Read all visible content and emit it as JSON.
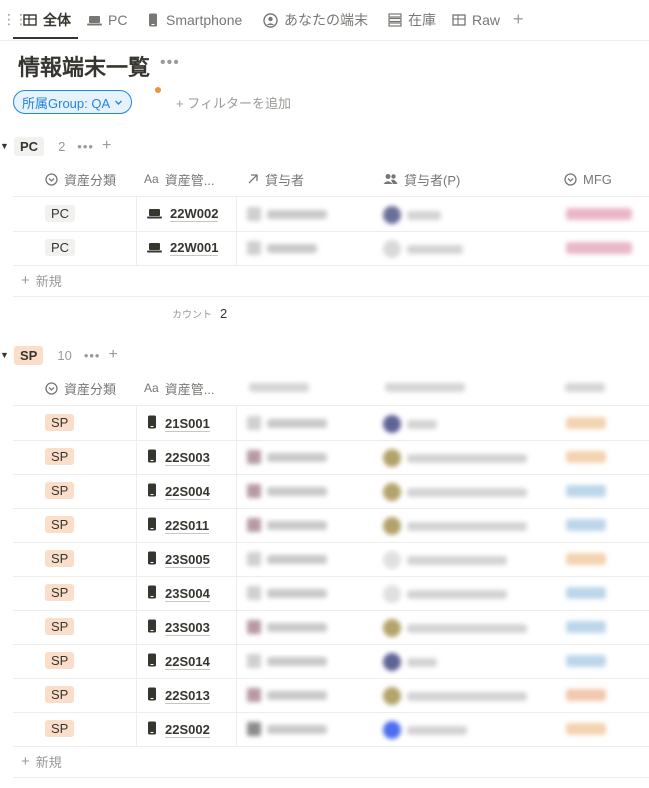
{
  "tabs": [
    {
      "label": "全体",
      "icon": "table-icon",
      "active": true
    },
    {
      "label": "PC",
      "icon": "laptop-icon"
    },
    {
      "label": "Smartphone",
      "icon": "phone-icon"
    },
    {
      "label": "あなたの端末",
      "icon": "user-circle-icon"
    },
    {
      "label": "在庫",
      "icon": "list-icon"
    },
    {
      "label": "Raw",
      "icon": "table-icon"
    }
  ],
  "page": {
    "title": "情報端末一覧"
  },
  "filter": {
    "chip_label": "所属Group: QA",
    "add_label": "フィルターを追加"
  },
  "columns": {
    "category": "資産分類",
    "asset_id": "資産管...",
    "lender": "貸与者",
    "lender_person": "貸与者(P)",
    "mfg": "MFG"
  },
  "groups": {
    "pc": {
      "label": "PC",
      "count": "2",
      "rows": [
        {
          "category": "PC",
          "id": "22W002"
        },
        {
          "category": "PC",
          "id": "22W001"
        }
      ],
      "new_label": "新規",
      "count_label": "カウント",
      "count_value": "2"
    },
    "sp": {
      "label": "SP",
      "count": "10",
      "rows": [
        {
          "category": "SP",
          "id": "21S001"
        },
        {
          "category": "SP",
          "id": "22S003"
        },
        {
          "category": "SP",
          "id": "22S004"
        },
        {
          "category": "SP",
          "id": "22S011"
        },
        {
          "category": "SP",
          "id": "23S005"
        },
        {
          "category": "SP",
          "id": "23S004"
        },
        {
          "category": "SP",
          "id": "23S003"
        },
        {
          "category": "SP",
          "id": "22S014"
        },
        {
          "category": "SP",
          "id": "22S013"
        },
        {
          "category": "SP",
          "id": "22S002"
        }
      ],
      "new_label": "新規"
    }
  },
  "colors": {
    "accent": "#2383e2",
    "pc_tag": "#f1f1ef",
    "sp_tag": "#fadec9",
    "notify_dot": "#f2923c"
  }
}
